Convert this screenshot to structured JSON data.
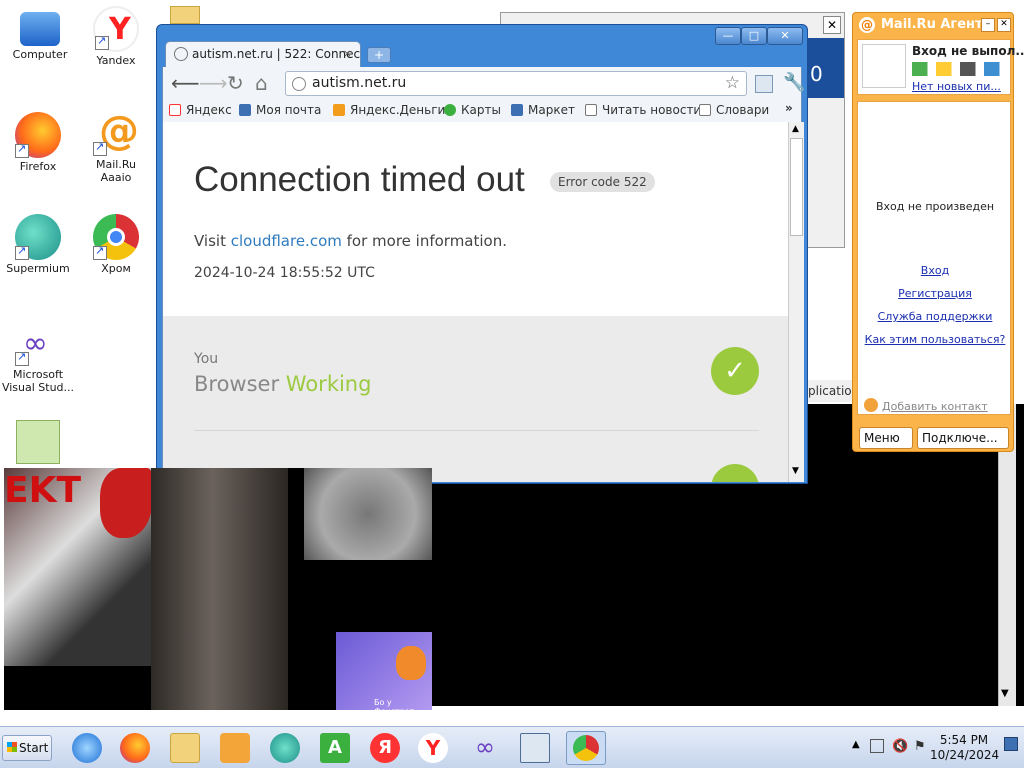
{
  "desktop": {
    "icons": [
      {
        "label": "Computer"
      },
      {
        "label": "Yandex"
      },
      {
        "label": "Firefox"
      },
      {
        "label": "Mail.Ru Aaaio"
      },
      {
        "label": "Supermium"
      },
      {
        "label": "Хром"
      },
      {
        "label": "Microsoft Visual Stud..."
      }
    ]
  },
  "chrome": {
    "tab_title": "autism.net.ru | 522: Connec",
    "tab_close": "×",
    "new_tab": "+",
    "url": "autism.net.ru",
    "bookmarks": [
      "Яндекс",
      "Моя почта",
      "Яндекс.Деньги",
      "Карты",
      "Маркет",
      "Читать новости",
      "Словари"
    ],
    "bookmarks_more": "»",
    "page": {
      "heading": "Connection timed out",
      "error_code": "Error code 522",
      "visit_prefix": "Visit ",
      "visit_link": "cloudflare.com",
      "visit_suffix": " for more information.",
      "timestamp": "2024-10-24 18:55:52 UTC",
      "you_label": "You",
      "browser_label": "Browser",
      "browser_status": "Working"
    }
  },
  "background_window": {
    "blue_digit": "0",
    "partial_text": "plication"
  },
  "agent": {
    "title": "Mail.Ru Агент",
    "logo": "@",
    "status": "Вход не выпол...",
    "no_messages": "Нет новых пи...",
    "not_logged": "Вход не произведен",
    "links": [
      "Вход",
      "Регистрация",
      "Служба поддержки",
      "Как этим пользоваться?"
    ],
    "add_contact": "Добавить контакт",
    "menu_button": "Меню",
    "connect_button": "Подключе..."
  },
  "collage": {
    "text_a": "EKT",
    "caption_d": "Бо у Фокстрот"
  },
  "taskbar": {
    "start_label": "Start",
    "time": "5:54 PM",
    "date": "10/24/2024"
  },
  "colors": {
    "chrome_frame": "#3f88d7",
    "link": "#2f7bbf",
    "ok_green": "#9bca3e",
    "agent_orange": "#fbb44a"
  }
}
